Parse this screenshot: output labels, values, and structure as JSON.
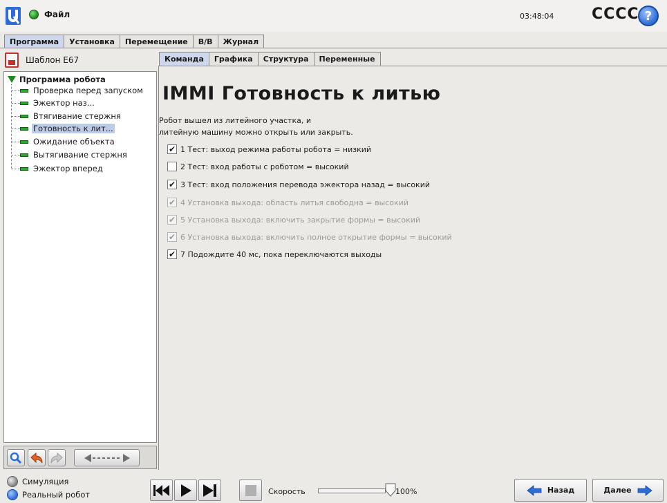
{
  "header": {
    "file_label": "Файл",
    "clock": "03:48:04",
    "robot_name": "CCCC",
    "help_label": "?"
  },
  "main_tabs": [
    "Программа",
    "Установка",
    "Перемещение",
    "В/В",
    "Журнал"
  ],
  "active_main_tab": "Программа",
  "left_panel": {
    "template_name": "Шаблон E67",
    "tree_root": "Программа робота",
    "tree_items": [
      "Проверка перед запуском",
      "Эжектор наз...",
      "Втягивание стержня",
      "Готовность к лит...",
      "Ожидание объекта",
      "Вытягивание стержня",
      "Эжектор вперед"
    ],
    "selected_item": "Готовность к лит..."
  },
  "sub_tabs": [
    "Команда",
    "Графика",
    "Структура",
    "Переменные"
  ],
  "active_sub_tab": "Команда",
  "content": {
    "title": "IMMI Готовность к литью",
    "description_line1": "Робот вышел из литейного участка, и",
    "description_line2": "литейную машину можно открыть или закрыть.",
    "checks": [
      {
        "label": "1 Тест: выход режима работы робота = низкий",
        "checked": true,
        "enabled": true
      },
      {
        "label": "2 Тест: вход работы с роботом = высокий",
        "checked": false,
        "enabled": true
      },
      {
        "label": "3 Тест: вход положения перевода эжектора назад = высокий",
        "checked": true,
        "enabled": true
      },
      {
        "label": "4 Установка выхода: область литья свободна = высокий",
        "checked": true,
        "enabled": false
      },
      {
        "label": "5 Установка выхода: включить закрытие формы = высокий",
        "checked": true,
        "enabled": false
      },
      {
        "label": "6 Установка выхода: включить полное открытие формы = высокий",
        "checked": true,
        "enabled": false
      },
      {
        "label": "7 Подождите 40 мс, пока переключаются выходы",
        "checked": true,
        "enabled": true
      }
    ]
  },
  "footer": {
    "mode_simulation": "Симуляция",
    "mode_real": "Реальный робот",
    "speed_label": "Скорость",
    "speed_value": "100%",
    "speed_fraction": 1.0,
    "back_label": "Назад",
    "next_label": "Далее"
  },
  "colors": {
    "accent_blue": "#2d6cd6",
    "active_tab": "#cfd7ec",
    "selection": "#bccbe6",
    "command_green": "#28a828"
  },
  "icons": [
    "ur-logo-icon",
    "status-ball-icon",
    "help-icon",
    "template-file-icon",
    "search-icon",
    "undo-icon",
    "redo-icon",
    "move-arrow-icon",
    "skip-back-icon",
    "play-icon",
    "skip-forward-icon",
    "stop-icon",
    "back-arrow-icon",
    "next-arrow-icon"
  ]
}
